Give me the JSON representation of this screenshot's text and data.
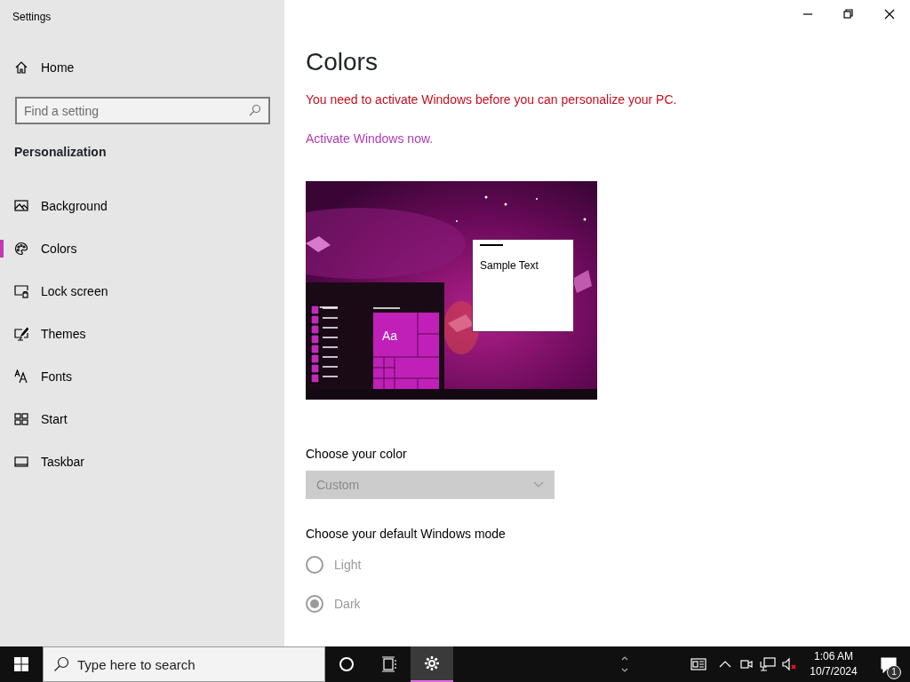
{
  "window": {
    "title": "Settings"
  },
  "sidebar": {
    "home": "Home",
    "search": {
      "placeholder": "Find a setting"
    },
    "section": "Personalization",
    "items": [
      {
        "label": "Background",
        "selected": false
      },
      {
        "label": "Colors",
        "selected": true
      },
      {
        "label": "Lock screen",
        "selected": false
      },
      {
        "label": "Themes",
        "selected": false
      },
      {
        "label": "Fonts",
        "selected": false
      },
      {
        "label": "Start",
        "selected": false
      },
      {
        "label": "Taskbar",
        "selected": false
      }
    ]
  },
  "content": {
    "title": "Colors",
    "warning": "You need to activate Windows before you can personalize your PC.",
    "activate_link": "Activate Windows now.",
    "preview": {
      "tile_text": "Aa",
      "sample_text": "Sample Text"
    },
    "color_label": "Choose your color",
    "color_dropdown": {
      "value": "Custom",
      "disabled": true
    },
    "windows_mode_label": "Choose your default Windows mode",
    "windows_mode": [
      {
        "label": "Light",
        "selected": false,
        "disabled": true
      },
      {
        "label": "Dark",
        "selected": true,
        "disabled": true
      }
    ]
  },
  "taskbar": {
    "search_placeholder": "Type here to search",
    "settings_app_active": true,
    "time": "1:06 AM",
    "date": "10/7/2024",
    "notification_count": "1"
  }
}
